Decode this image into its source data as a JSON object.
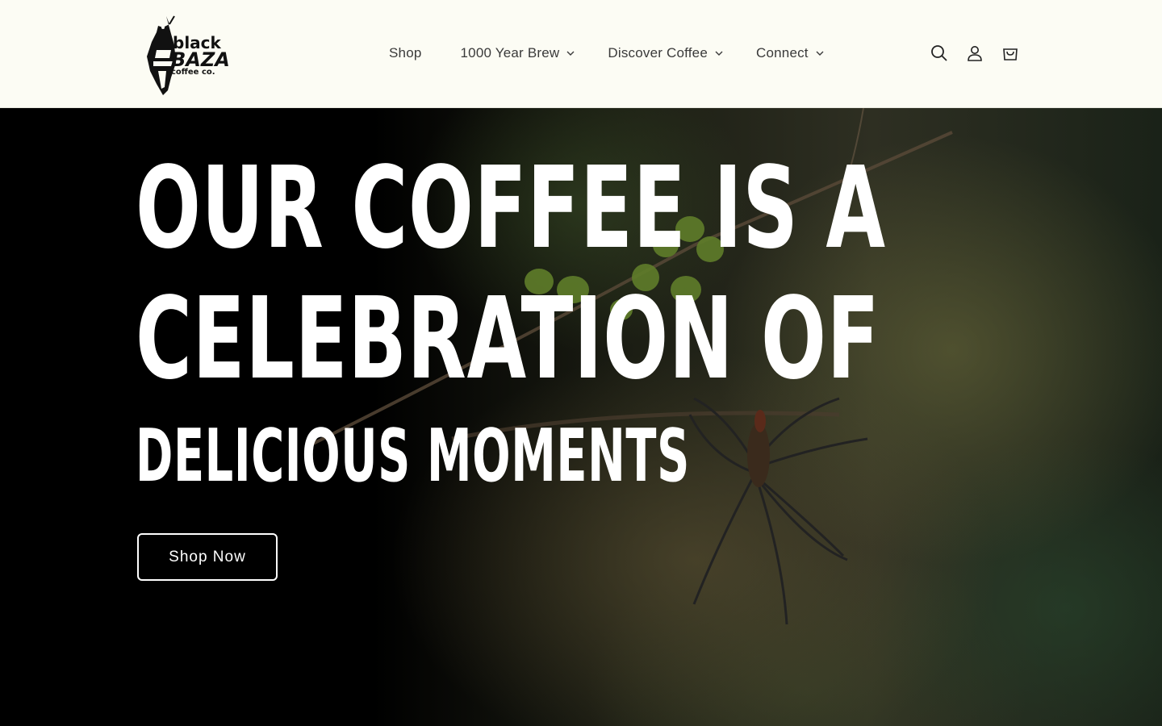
{
  "brand": {
    "name": "black BAZA coffee co.",
    "logo_lines": [
      "black",
      "BAZA",
      "coffee co."
    ]
  },
  "nav": {
    "items": [
      {
        "label": "Shop",
        "has_dropdown": false
      },
      {
        "label": "1000 Year Brew",
        "has_dropdown": true
      },
      {
        "label": "Discover Coffee",
        "has_dropdown": true
      },
      {
        "label": "Connect",
        "has_dropdown": true
      }
    ]
  },
  "header_icons": [
    "search-icon",
    "account-icon",
    "cart-icon"
  ],
  "hero": {
    "headline_line1": "OUR COFFEE IS A",
    "headline_line2": "CELEBRATION OF",
    "headline_line3": "DELICIOUS MOMENTS",
    "cta_label": "Shop Now"
  },
  "colors": {
    "header_bg": "#fcfcf4",
    "hero_text": "#ffffff",
    "nav_text": "#3a3a3a"
  }
}
